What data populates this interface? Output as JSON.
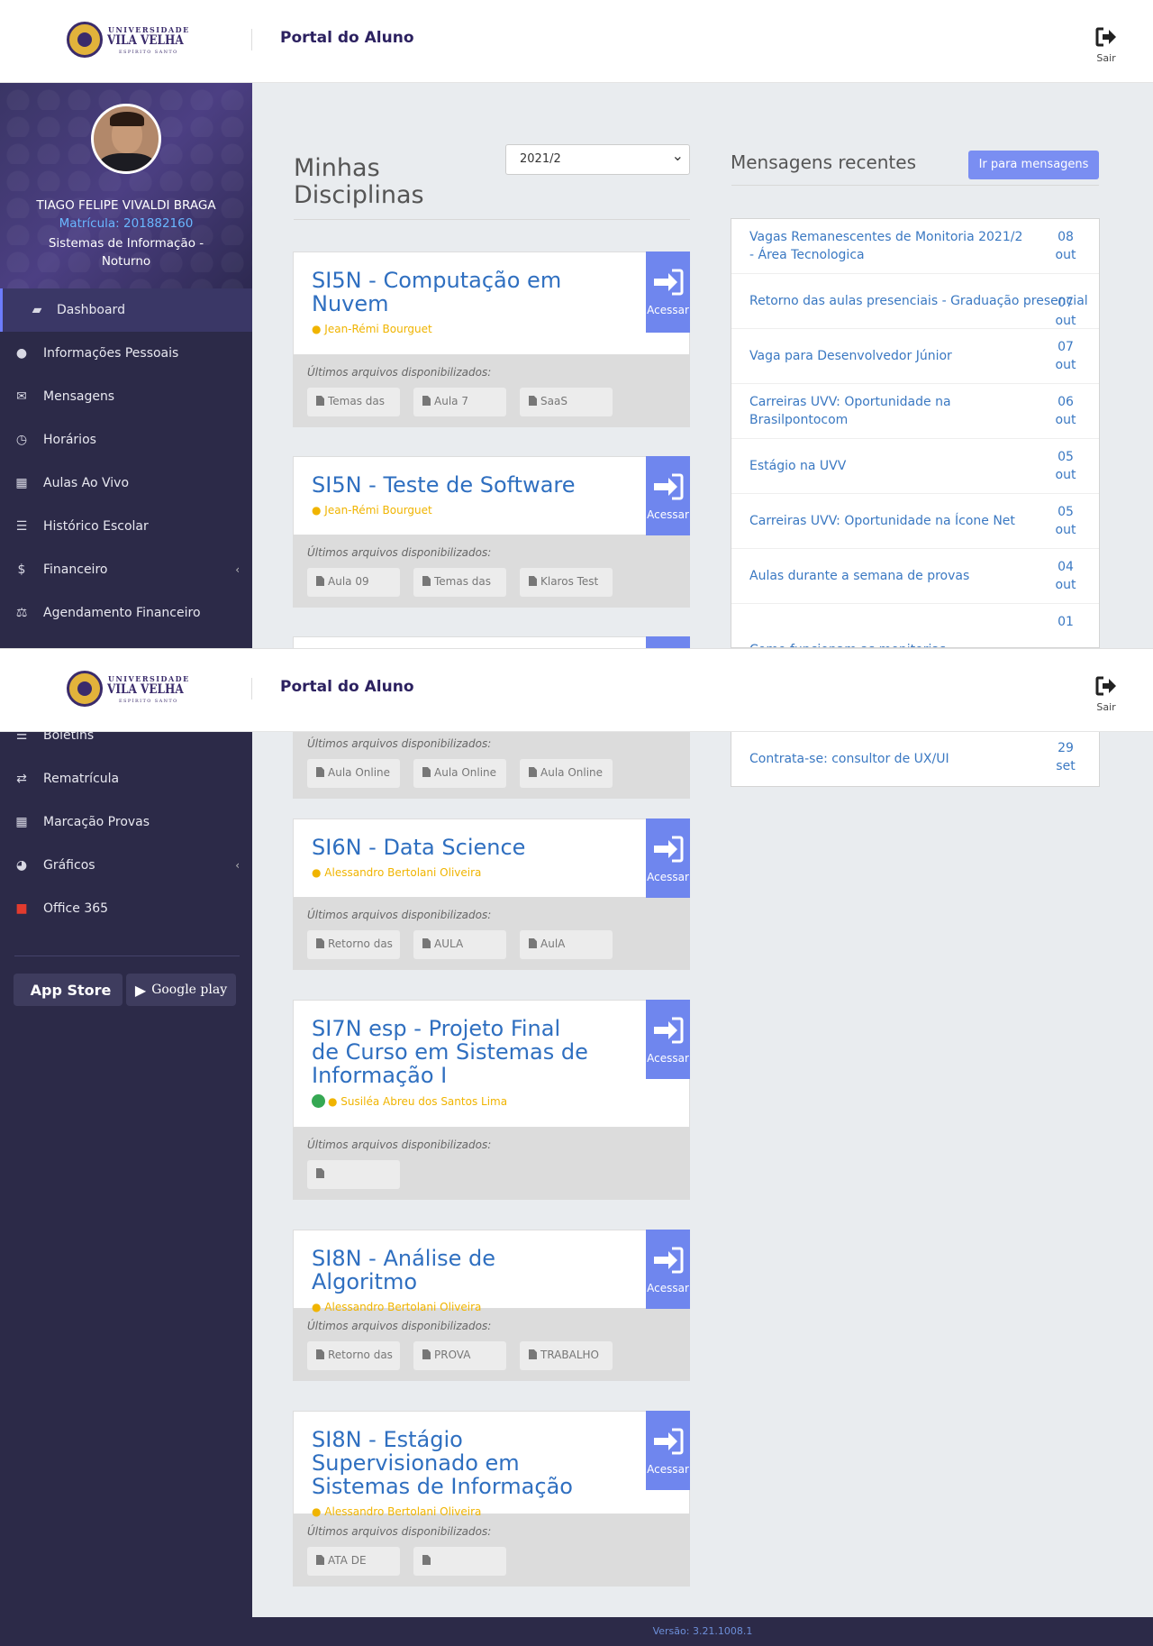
{
  "header": {
    "logo_small": "UNIVERSIDADE",
    "logo_main": "VILA VELHA",
    "logo_sub": "ESPÍRITO SANTO",
    "title": "Portal do Aluno",
    "logout_label": "Sair"
  },
  "profile": {
    "name": "TIAGO FELIPE VIVALDI BRAGA",
    "matricula": "Matrícula: 201882160",
    "course": "Sistemas de Informação - Noturno"
  },
  "nav_top": [
    {
      "label": "Dashboard",
      "icon": "book-icon"
    },
    {
      "label": "Informações Pessoais",
      "icon": "user-icon"
    },
    {
      "label": "Mensagens",
      "icon": "envelope-icon"
    },
    {
      "label": "Horários",
      "icon": "clock-icon"
    },
    {
      "label": "Aulas Ao Vivo",
      "icon": "calendar-icon"
    },
    {
      "label": "Histórico Escolar",
      "icon": "list-icon"
    },
    {
      "label": "Financeiro",
      "icon": "dollar-icon"
    },
    {
      "label": "Agendamento Financeiro",
      "icon": "balance-scale-icon"
    }
  ],
  "nav_bottom": [
    {
      "label": "Boletins",
      "icon": "list-icon"
    },
    {
      "label": "Rematrícula",
      "icon": "retweet-icon"
    },
    {
      "label": "Marcação Provas",
      "icon": "calendar-icon"
    },
    {
      "label": "Gráficos",
      "icon": "pie-chart-icon"
    },
    {
      "label": "Office 365",
      "icon": "office-icon"
    }
  ],
  "stores": {
    "app_store": "App Store",
    "google_play": "Google play"
  },
  "main": {
    "title": "Minhas Disciplinas",
    "period": "2021/2",
    "files_label": "Últimos arquivos disponibilizados:",
    "access_label": "Acessar"
  },
  "courses": [
    {
      "title": "SI5N - Computação em Nuvem",
      "professor": "Jean-Rémi Bourguet",
      "files": [
        "Temas das",
        "Aula 7",
        "SaaS"
      ]
    },
    {
      "title": "SI5N - Teste de Software",
      "professor": "Jean-Rémi Bourguet",
      "files": [
        "Aula 09",
        "Temas das",
        "Klaros Test"
      ]
    },
    {
      "title": "",
      "professor": "",
      "files": [
        "Aula Online",
        "Aula Online",
        "Aula Online"
      ]
    },
    {
      "title": "SI6N - Data Science",
      "professor": "Alessandro Bertolani Oliveira",
      "files": [
        "Retorno das",
        "AULA",
        "AulA"
      ]
    },
    {
      "title": "SI7N esp - Projeto Final de Curso em Sistemas de Informação I",
      "professor": "Susiléa Abreu dos Santos Lima",
      "files": [
        ""
      ]
    },
    {
      "title": "SI8N - Análise de Algoritmo",
      "professor": "Alessandro Bertolani Oliveira",
      "files": [
        "Retorno das",
        "PROVA",
        "TRABALHO"
      ]
    },
    {
      "title": "SI8N - Estágio Supervisionado em Sistemas de Informação",
      "professor": "Alessandro Bertolani Oliveira",
      "files": [
        "ATA DE",
        ""
      ]
    }
  ],
  "messages": {
    "title": "Mensagens recentes",
    "button": "Ir para mensagens",
    "items": [
      {
        "text": "Vagas Remanescentes de Monitoria 2021/2 - Área Tecnologica",
        "day": "08",
        "month": "out"
      },
      {
        "text": "Retorno das aulas presenciais - Graduação presencial",
        "day": "07",
        "month": "out"
      },
      {
        "text": "Vaga para Desenvolvedor Júnior",
        "day": "07",
        "month": "out"
      },
      {
        "text": "Carreiras UVV: Oportunidade na Brasilpontocom",
        "day": "06",
        "month": "out"
      },
      {
        "text": "Estágio na UVV",
        "day": "05",
        "month": "out"
      },
      {
        "text": "Carreiras UVV: Oportunidade na Ícone Net",
        "day": "05",
        "month": "out"
      },
      {
        "text": "Aulas durante a semana de provas",
        "day": "04",
        "month": "out"
      },
      {
        "text": "Como funcionam as monitorias",
        "day": "01",
        "month": ""
      },
      {
        "text": "Contrata-se: consultor de UX/UI",
        "day": "29",
        "month": "set"
      }
    ]
  },
  "footer": {
    "version": "Versão: 3.21.1008.1"
  }
}
